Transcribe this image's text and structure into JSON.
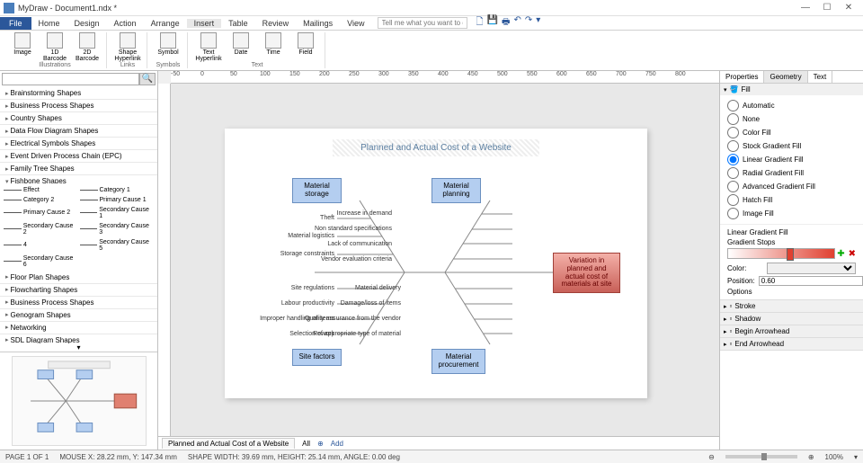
{
  "window": {
    "title": "MyDraw - Document1.ndx *"
  },
  "menu": {
    "file": "File",
    "items": [
      "Home",
      "Design",
      "Action",
      "Arrange",
      "Insert",
      "Table",
      "Review",
      "Mailings",
      "View"
    ],
    "search_placeholder": "Tell me what you want to do"
  },
  "ribbon": {
    "groups": [
      {
        "label": "Illustrations",
        "items": [
          {
            "name": "image",
            "label": "Image"
          },
          {
            "name": "barcode-1d",
            "label": "1D Barcode"
          },
          {
            "name": "barcode-2d",
            "label": "2D Barcode"
          }
        ]
      },
      {
        "label": "Links",
        "items": [
          {
            "name": "shape-hyperlink",
            "label": "Shape Hyperlink"
          }
        ]
      },
      {
        "label": "Symbols",
        "items": [
          {
            "name": "symbol",
            "label": "Symbol"
          }
        ]
      },
      {
        "label": "Text",
        "items": [
          {
            "name": "text-hyperlink",
            "label": "Text Hyperlink"
          },
          {
            "name": "date",
            "label": "Date"
          },
          {
            "name": "time",
            "label": "Time"
          },
          {
            "name": "field",
            "label": "Field"
          }
        ]
      }
    ]
  },
  "shape_categories": [
    "Brainstorming Shapes",
    "Business Process Shapes",
    "Country Shapes",
    "Data Flow Diagram Shapes",
    "Electrical Symbols Shapes",
    "Event Driven Process Chain (EPC)",
    "Family Tree Shapes",
    "Fishbone Shapes"
  ],
  "shape_items": [
    "Effect",
    "Category 1",
    "Category 2",
    "Primary Cause 1",
    "Primary Cause 2",
    "Secondary Cause 1",
    "Secondary Cause 2",
    "Secondary Cause 3",
    "4",
    "Secondary Cause 5",
    "Secondary Cause 6"
  ],
  "shape_categories_more": [
    "Floor Plan Shapes",
    "Flowcharting Shapes",
    "Business Process Shapes",
    "Genogram Shapes",
    "Networking",
    "SDL Diagram Shapes"
  ],
  "diagram": {
    "title": "Planned and Actual Cost of a Website",
    "boxes": {
      "storage": "Material storage",
      "planning": "Material planning",
      "site": "Site factors",
      "procurement": "Material procurement",
      "effect": "Variation in planned and actual cost of materials at site"
    },
    "causes_top_left": [
      "Theft",
      "Material logistics",
      "Storage constraints"
    ],
    "causes_top_right": [
      "Increase in demand",
      "Non standard specifications",
      "Lack of communication",
      "Vendor evaluation criteria"
    ],
    "causes_bot_left": [
      "Site regulations",
      "Labour productivity",
      "Improper handling of items",
      "Rework"
    ],
    "causes_bot_right": [
      "Material delivery",
      "Damage/loss of items",
      "Quality assurance from the vendor",
      "Selection of appropriate type of material"
    ]
  },
  "page_tab": {
    "name": "Planned and Actual Cost of a Website",
    "all": "All",
    "add": "Add"
  },
  "right": {
    "tabs": [
      "Properties",
      "Geometry",
      "Text"
    ],
    "fill_section": "Fill",
    "fill_options": [
      "Automatic",
      "None",
      "Color Fill",
      "Stock Gradient Fill",
      "Linear Gradient Fill",
      "Radial Gradient Fill",
      "Advanced Gradient Fill",
      "Hatch Fill",
      "Image Fill"
    ],
    "fill_selected": "Linear Gradient Fill",
    "lgf_label": "Linear Gradient Fill",
    "grad_stops": "Gradient Stops",
    "color_label": "Color:",
    "position_label": "Position:",
    "position_value": "0.60",
    "options": "Options",
    "sections": [
      "Stroke",
      "Shadow",
      "Begin Arrowhead",
      "End Arrowhead"
    ]
  },
  "status": {
    "page": "PAGE 1 OF 1",
    "mouse": "MOUSE X: 28.22 mm, Y: 147.34 mm",
    "shape": "SHAPE WIDTH: 39.69 mm, HEIGHT: 25.14 mm, ANGLE: 0.00 deg",
    "zoom": "100%"
  },
  "ruler_ticks": [
    "-50",
    "0",
    "50",
    "100",
    "150",
    "200",
    "250",
    "300",
    "350",
    "400",
    "450",
    "500",
    "550",
    "600",
    "650",
    "700",
    "750",
    "800"
  ]
}
